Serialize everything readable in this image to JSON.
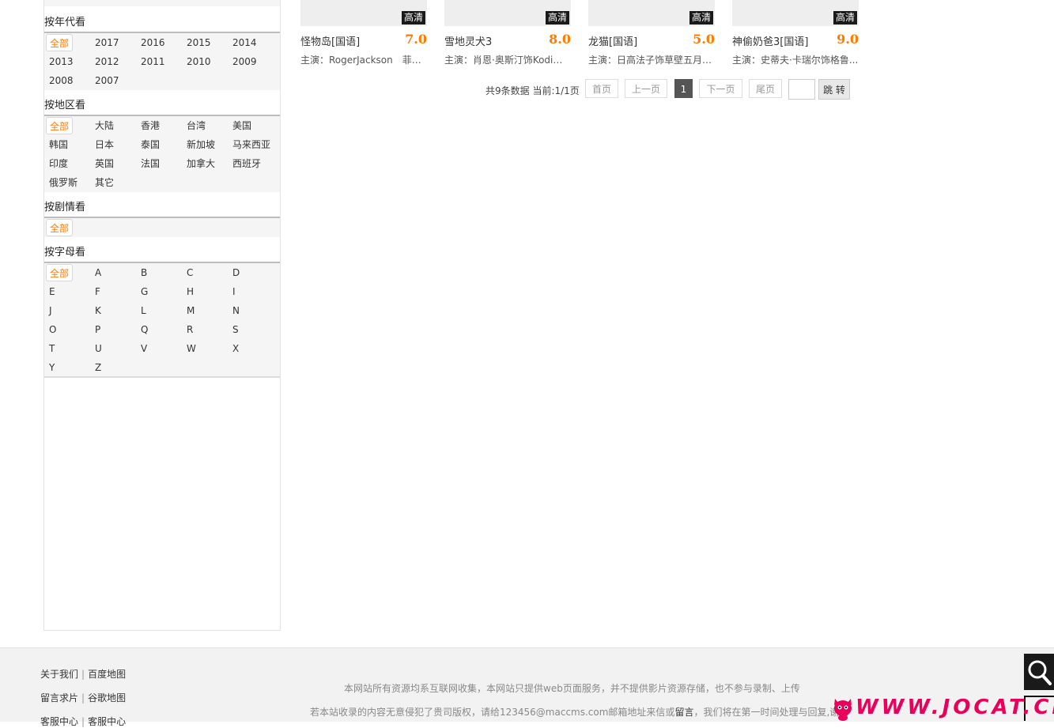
{
  "sidebar": {
    "year": {
      "title": "按年代看",
      "items": [
        "全部",
        "2017",
        "2016",
        "2015",
        "2014",
        "2013",
        "2012",
        "2011",
        "2010",
        "2009",
        "2008",
        "2007"
      ]
    },
    "region": {
      "title": "按地区看",
      "items": [
        "全部",
        "大陆",
        "香港",
        "台湾",
        "美国",
        "韩国",
        "日本",
        "泰国",
        "新加坡",
        "马来西亚",
        "印度",
        "英国",
        "法国",
        "加拿大",
        "西班牙",
        "俄罗斯",
        "其它"
      ]
    },
    "plot": {
      "title": "按剧情看",
      "items": [
        "全部"
      ]
    },
    "letter": {
      "title": "按字母看",
      "items": [
        "全部",
        "A",
        "B",
        "C",
        "D",
        "E",
        "F",
        "G",
        "H",
        "I",
        "J",
        "K",
        "L",
        "M",
        "N",
        "O",
        "P",
        "Q",
        "R",
        "S",
        "T",
        "U",
        "V",
        "W",
        "X",
        "Y",
        "Z"
      ]
    }
  },
  "cards": [
    {
      "badge": "高清",
      "title": "怪物岛[国语]",
      "score": "7.0",
      "cast": "主演：RogerJackson　菲奥..."
    },
    {
      "badge": "高清",
      "title": "雪地灵犬3",
      "score": "8.0",
      "cast": "主演：肖恩·奥斯汀饰Kodi　J..."
    },
    {
      "badge": "高清",
      "title": "龙猫[国语]",
      "score": "5.0",
      "cast": "主演：日高法子饰草壁五月　..."
    },
    {
      "badge": "高清",
      "title": "神偷奶爸3[国语]",
      "score": "9.0",
      "cast": "主演：史蒂夫·卡瑞尔饰格鲁..."
    }
  ],
  "pager": {
    "info": "共9条数据 当前:1/1页",
    "first": "首页",
    "prev": "上一页",
    "current": "1",
    "next": "下一页",
    "last": "尾页",
    "input_value": "",
    "jump": "跳 转"
  },
  "footer": {
    "about": "关于我们",
    "baidu_map": "百度地图",
    "message": "留言求片",
    "google_map": "谷歌地图",
    "help1": "客服中心",
    "help2": "客服中心",
    "sep": "|",
    "note1": "本网站所有资源均系互联网收集，本网站只提供web页面服务，并不提供影片资源存储，也不参与录制、上传",
    "note2_pre": "若本站收录的内容无意侵犯了贵司版权，请给123456@maccms.com邮箱地址来信或",
    "note2_link": "留言",
    "note2_post": "，我们将在第一时间处理与回复,谢谢"
  },
  "watermark": "WWW.JOCAT.CN",
  "colors": {
    "accent": "#ff7a00",
    "badge": "#1a1a1a",
    "watermark": "#e8005a"
  }
}
